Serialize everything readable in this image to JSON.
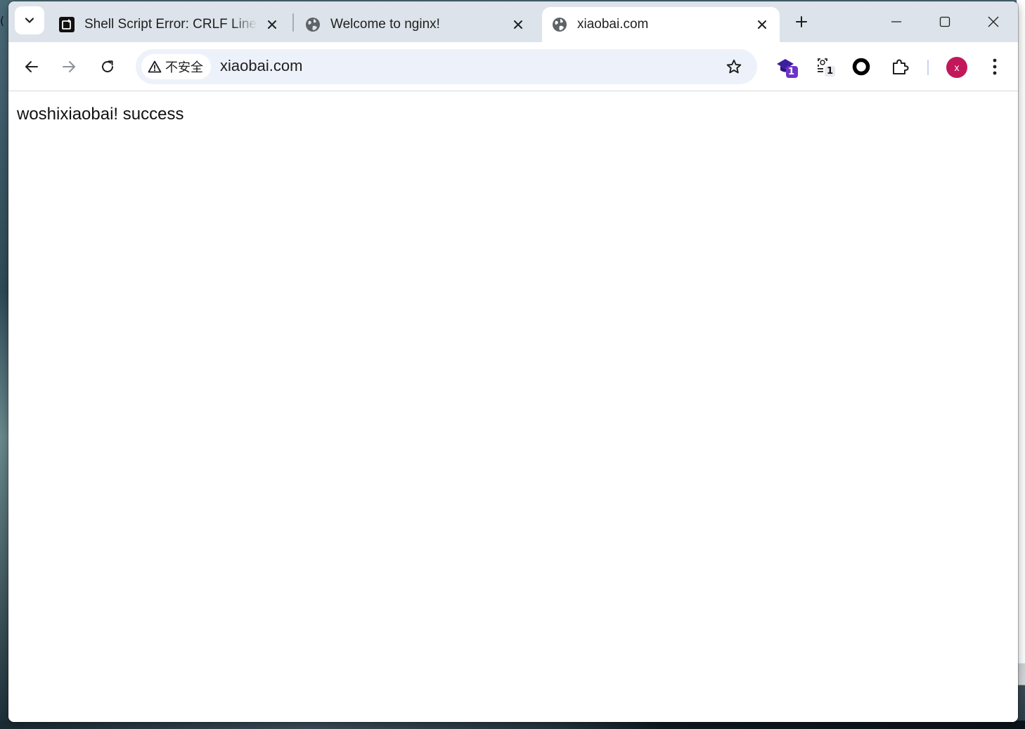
{
  "desktop": {
    "left_glyph": "("
  },
  "tabs": [
    {
      "title": "Shell Script Error: CRLF Line",
      "favicon": "chatgpt-icon",
      "active": false
    },
    {
      "title": "Welcome to nginx!",
      "favicon": "globe-icon",
      "active": false
    },
    {
      "title": "xiaobai.com",
      "favicon": "globe-icon",
      "active": true
    }
  ],
  "toolbar": {
    "security_label": "不安全",
    "url": "xiaobai.com",
    "extensions": [
      {
        "icon": "extension-graduation-cap-icon",
        "badge": "1",
        "badge_color": "#6b34c9"
      },
      {
        "icon": "extension-screenshot-icon",
        "badge": "1",
        "badge_color": "#e8eaed"
      },
      {
        "icon": "extension-ring-icon"
      },
      {
        "icon": "extensions-puzzle-icon"
      }
    ],
    "profile_initial": "x",
    "profile_color": "#c2185b"
  },
  "page": {
    "body_text": "woshixiaobai! success"
  },
  "colors": {
    "tabstrip_bg": "#dde3ea",
    "omnibox_bg": "#edf2fa",
    "active_tab_bg": "#ffffff"
  }
}
